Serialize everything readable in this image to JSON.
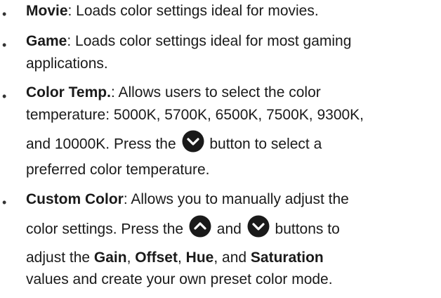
{
  "bullet_char": "•",
  "items": {
    "movie": {
      "term": "Movie",
      "desc": ": Loads color settings ideal for movies."
    },
    "game": {
      "term": "Game",
      "desc_line1": ": Loads color settings ideal for most gaming",
      "desc_line2": "applications."
    },
    "color_temp": {
      "term": "Color Temp.",
      "desc_line1": ": Allows users to select the color",
      "desc_line2": "temperature: 5000K, 5700K, 6500K, 7500K, 9300K,",
      "desc_line3_pre": "and 10000K. Press the",
      "desc_line3_post": "button to select a",
      "desc_line4": "preferred color temperature."
    },
    "custom_color": {
      "term": "Custom Color",
      "desc_line1": ": Allows you to manually adjust the",
      "desc_line2_pre": "color settings. Press the",
      "desc_line2_mid": "and",
      "desc_line2_post": "buttons to",
      "desc_line3_pre": "adjust the",
      "gain": "Gain",
      "sep1": ",",
      "offset": "Offset",
      "sep2": ",",
      "hue": "Hue",
      "sep3": ", and",
      "saturation": "Saturation",
      "desc_line4": "values and create your own preset color mode."
    }
  },
  "icons": {
    "down": "chevron-down-circle-icon",
    "up": "chevron-up-circle-icon",
    "color": "#1a1a1a"
  }
}
